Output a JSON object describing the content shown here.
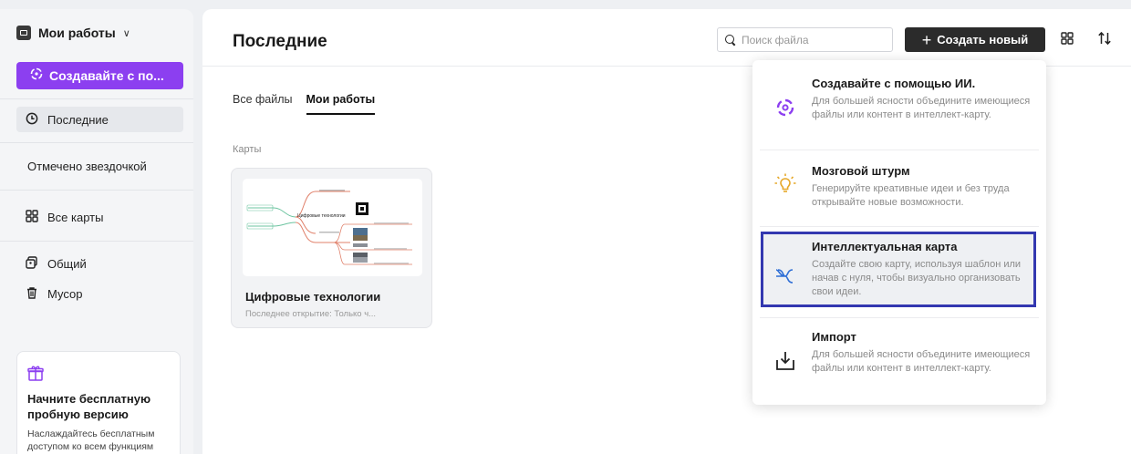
{
  "sidebar": {
    "workspace_label": "Мои работы",
    "workspace_chevron": "∨",
    "ai_button_label": "Создавайте с по...",
    "items": [
      {
        "label": "Последние",
        "icon": "clock-icon"
      },
      {
        "label": "Отмечено звездочкой"
      },
      {
        "label": "Все карты",
        "icon": "grid-icon"
      },
      {
        "label": "Общий",
        "icon": "shared-icon"
      },
      {
        "label": "Мусор",
        "icon": "trash-icon"
      }
    ],
    "trial": {
      "icon": "gift-icon",
      "title": "Начните бесплатную пробную версию",
      "text": "Наслаждайтесь бесплатным доступом ко всем функциям Xmind!"
    }
  },
  "header": {
    "title": "Последние",
    "search_placeholder": "Поиск файла",
    "create_label": "Создать новый",
    "create_plus": "+"
  },
  "tabs": [
    {
      "label": "Все файлы",
      "active": false
    },
    {
      "label": "Мои работы",
      "active": true
    }
  ],
  "section_label": "Карты",
  "file": {
    "name": "Цифровые технологии",
    "meta": "Последнее открытие: Только ч...",
    "thumb_central": "Цифровые технологии"
  },
  "dropdown": {
    "items": [
      {
        "title": "Создавайте с помощью ИИ.",
        "desc": "Для большей ясности объедините имеющиеся файлы или контент в интеллект-карту.",
        "icon": "ai-sparkle-icon",
        "color": "#8c3ff0"
      },
      {
        "title": "Мозговой штурм",
        "desc": "Генерируйте креативные идеи и без труда открывайте новые возможности.",
        "icon": "lightbulb-icon",
        "color": "#e6a82a"
      },
      {
        "title": "Интеллектуальная карта",
        "desc": "Создайте свою карту, используя шаблон или начав с нуля, чтобы визуально организовать свои идеи.",
        "icon": "mindmap-icon",
        "color": "#2f6fd6",
        "highlighted": true
      },
      {
        "title": "Импорт",
        "desc": "Для большей ясности объедините имеющиеся файлы или контент в интеллект-карту.",
        "icon": "import-icon",
        "color": "#222222"
      }
    ]
  },
  "colors": {
    "accent_purple": "#8c3ff0",
    "create_button_bg": "#2b2b2b",
    "highlight_border": "#3338b0"
  }
}
